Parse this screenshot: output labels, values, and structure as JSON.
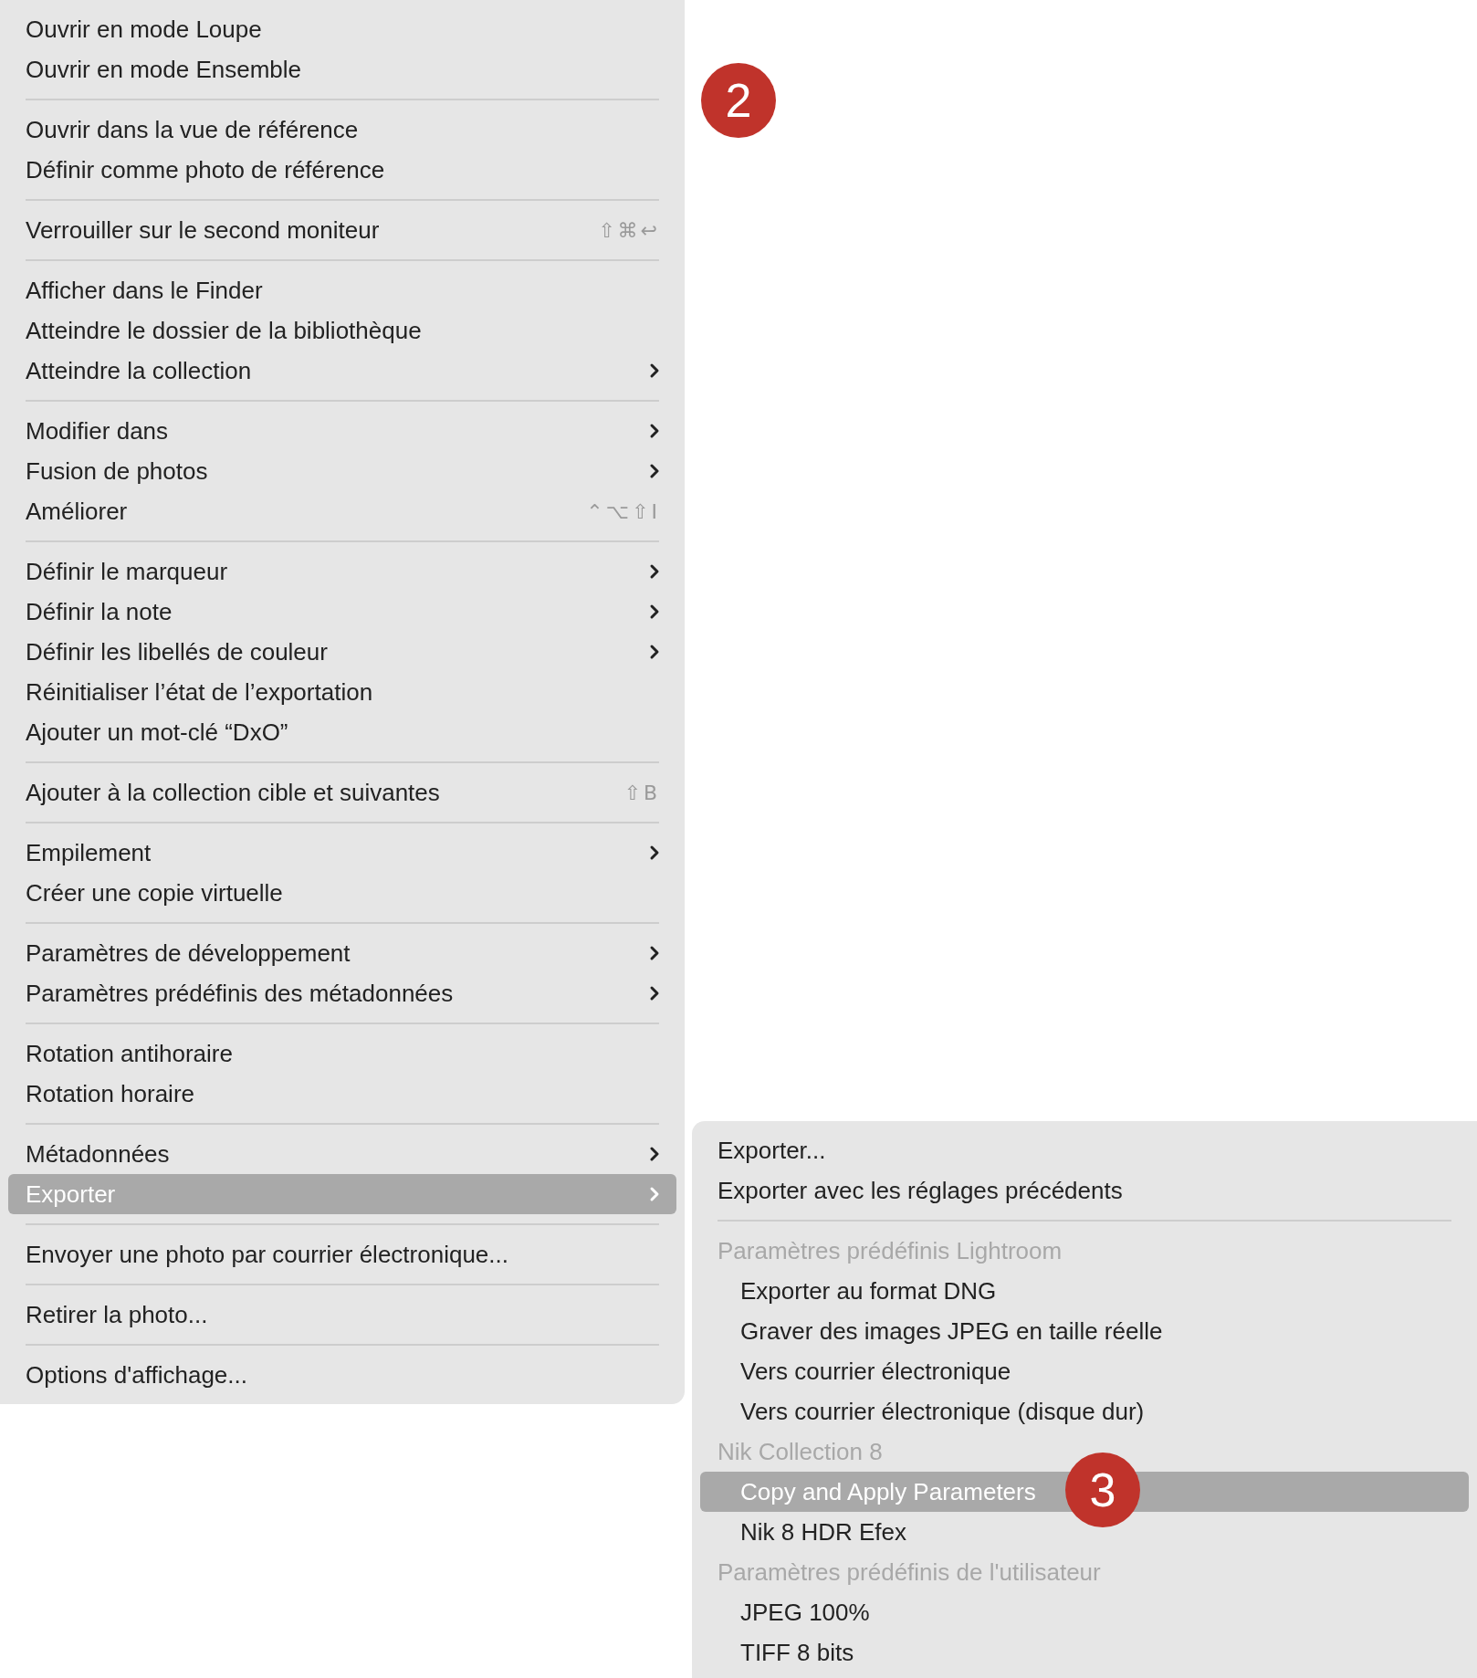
{
  "main_menu": {
    "items": [
      {
        "kind": "item",
        "label": "Ouvrir en mode Loupe",
        "submenu": false,
        "selected": false
      },
      {
        "kind": "item",
        "label": "Ouvrir en mode Ensemble",
        "submenu": false,
        "selected": false
      },
      {
        "kind": "separator"
      },
      {
        "kind": "item",
        "label": "Ouvrir dans la vue de référence",
        "submenu": false,
        "selected": false
      },
      {
        "kind": "item",
        "label": "Définir comme photo de référence",
        "submenu": false,
        "selected": false
      },
      {
        "kind": "separator"
      },
      {
        "kind": "item",
        "label": "Verrouiller sur le second moniteur",
        "shortcut": "⇧⌘↩",
        "submenu": false,
        "selected": false
      },
      {
        "kind": "separator"
      },
      {
        "kind": "item",
        "label": "Afficher dans le Finder",
        "submenu": false,
        "selected": false
      },
      {
        "kind": "item",
        "label": "Atteindre le dossier de la bibliothèque",
        "submenu": false,
        "selected": false
      },
      {
        "kind": "item",
        "label": "Atteindre la collection",
        "submenu": true,
        "selected": false
      },
      {
        "kind": "separator"
      },
      {
        "kind": "item",
        "label": "Modifier dans",
        "submenu": true,
        "selected": false
      },
      {
        "kind": "item",
        "label": "Fusion de photos",
        "submenu": true,
        "selected": false
      },
      {
        "kind": "item",
        "label": "Améliorer",
        "shortcut": "⌃⌥⇧I",
        "submenu": false,
        "selected": false
      },
      {
        "kind": "separator"
      },
      {
        "kind": "item",
        "label": "Définir le marqueur",
        "submenu": true,
        "selected": false
      },
      {
        "kind": "item",
        "label": "Définir la note",
        "submenu": true,
        "selected": false
      },
      {
        "kind": "item",
        "label": "Définir les libellés de couleur",
        "submenu": true,
        "selected": false
      },
      {
        "kind": "item",
        "label": "Réinitialiser l’état de l’exportation",
        "submenu": false,
        "selected": false
      },
      {
        "kind": "item",
        "label": "Ajouter un mot-clé “DxO”",
        "submenu": false,
        "selected": false
      },
      {
        "kind": "separator"
      },
      {
        "kind": "item",
        "label": "Ajouter à la collection cible et suivantes",
        "shortcut": "⇧B",
        "submenu": false,
        "selected": false
      },
      {
        "kind": "separator"
      },
      {
        "kind": "item",
        "label": "Empilement",
        "submenu": true,
        "selected": false
      },
      {
        "kind": "item",
        "label": "Créer une copie virtuelle",
        "submenu": false,
        "selected": false
      },
      {
        "kind": "separator"
      },
      {
        "kind": "item",
        "label": "Paramètres de développement",
        "submenu": true,
        "selected": false
      },
      {
        "kind": "item",
        "label": "Paramètres prédéfinis des métadonnées",
        "submenu": true,
        "selected": false
      },
      {
        "kind": "separator"
      },
      {
        "kind": "item",
        "label": "Rotation antihoraire",
        "submenu": false,
        "selected": false
      },
      {
        "kind": "item",
        "label": "Rotation horaire",
        "submenu": false,
        "selected": false
      },
      {
        "kind": "separator"
      },
      {
        "kind": "item",
        "label": "Métadonnées",
        "submenu": true,
        "selected": false
      },
      {
        "kind": "item",
        "label": "Exporter",
        "submenu": true,
        "selected": true
      },
      {
        "kind": "separator"
      },
      {
        "kind": "item",
        "label": "Envoyer une photo par courrier électronique...",
        "submenu": false,
        "selected": false
      },
      {
        "kind": "separator"
      },
      {
        "kind": "item",
        "label": "Retirer la photo...",
        "submenu": false,
        "selected": false
      },
      {
        "kind": "separator"
      },
      {
        "kind": "item",
        "label": "Options d'affichage...",
        "submenu": false,
        "selected": false
      }
    ]
  },
  "export_submenu": {
    "items": [
      {
        "kind": "item",
        "label": "Exporter...",
        "selected": false
      },
      {
        "kind": "item",
        "label": "Exporter avec les réglages précédents",
        "selected": false
      },
      {
        "kind": "separator"
      },
      {
        "kind": "group",
        "label": "Paramètres prédéfinis Lightroom",
        "children": [
          {
            "label": "Exporter au format DNG",
            "selected": false
          },
          {
            "label": "Graver des images JPEG en taille réelle",
            "selected": false
          },
          {
            "label": "Vers courrier électronique",
            "selected": false
          },
          {
            "label": "Vers courrier électronique (disque dur)",
            "selected": false
          }
        ]
      },
      {
        "kind": "group",
        "label": "Nik Collection 8",
        "children": [
          {
            "label": "Copy and Apply Parameters",
            "selected": true
          },
          {
            "label": "Nik 8 HDR Efex",
            "selected": false
          }
        ]
      },
      {
        "kind": "group",
        "label": "Paramètres prédéfinis de l'utilisateur",
        "children": [
          {
            "label": "JPEG 100%",
            "selected": false
          },
          {
            "label": "TIFF 8 bits",
            "selected": false
          }
        ]
      }
    ]
  },
  "callouts": [
    "2",
    "3"
  ]
}
